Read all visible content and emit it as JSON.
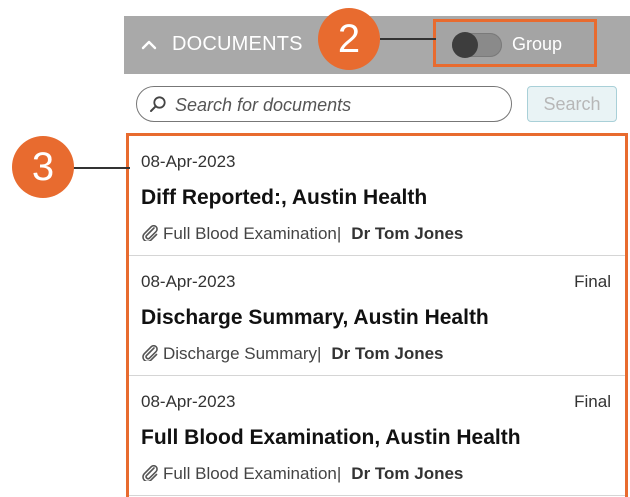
{
  "header": {
    "title": "DOCUMENTS",
    "collapse_icon": "chevron-up-icon",
    "group_toggle": {
      "label": "Group",
      "state": "off"
    }
  },
  "search": {
    "placeholder": "Search for documents",
    "value": "",
    "button_label": "Search",
    "icon": "search-icon"
  },
  "documents": [
    {
      "date": "08-Apr-2023",
      "status": "",
      "title": "Diff Reported:, Austin Health",
      "attachment_icon": "paperclip-icon",
      "type": "Full Blood Examination|",
      "author": "Dr Tom Jones"
    },
    {
      "date": "08-Apr-2023",
      "status": "Final",
      "title": "Discharge Summary, Austin Health",
      "attachment_icon": "paperclip-icon",
      "type": "Discharge Summary|",
      "author": "Dr Tom Jones"
    },
    {
      "date": "08-Apr-2023",
      "status": "Final",
      "title": "Full Blood Examination, Austin Health",
      "attachment_icon": "paperclip-icon",
      "type": "Full Blood Examination|",
      "author": "Dr Tom Jones"
    }
  ],
  "callouts": {
    "group_toggle": "2",
    "document_list": "3"
  },
  "colors": {
    "header_bg": "#a9a9a9",
    "annotation_accent": "#e86b2f",
    "search_button_border": "#a9d0d8"
  }
}
